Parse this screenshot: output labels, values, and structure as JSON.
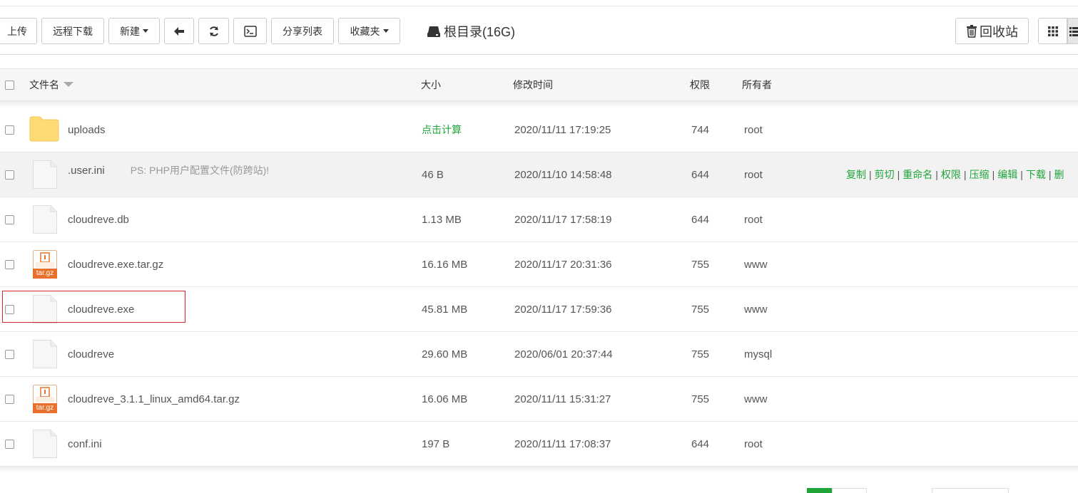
{
  "toolbar": {
    "upload": "上传",
    "remote_download": "远程下载",
    "new": "新建",
    "share_list": "分享列表",
    "favorites": "收藏夹",
    "current_dir": "根目录(16G)",
    "recycle_bin": "回收站"
  },
  "table": {
    "headers": {
      "filename": "文件名",
      "size": "大小",
      "modified": "修改时间",
      "permission": "权限",
      "owner": "所有者"
    },
    "rows": [
      {
        "name": "uploads",
        "type": "folder",
        "size": "点击计算",
        "modified": "2020/11/11 17:19:25",
        "perm": "744",
        "owner": "root"
      },
      {
        "name": ".user.ini",
        "type": "file",
        "note": "PS: PHP用户配置文件(防跨站)!",
        "size": "46 B",
        "modified": "2020/11/10 14:58:48",
        "perm": "644",
        "owner": "root",
        "actions": [
          "复制",
          "剪切",
          "重命名",
          "权限",
          "压缩",
          "编辑",
          "下载",
          "删"
        ]
      },
      {
        "name": "cloudreve.db",
        "type": "file",
        "size": "1.13 MB",
        "modified": "2020/11/17 17:58:19",
        "perm": "644",
        "owner": "root"
      },
      {
        "name": "cloudreve.exe.tar.gz",
        "type": "archive",
        "size": "16.16 MB",
        "modified": "2020/11/17 20:31:36",
        "perm": "755",
        "owner": "www"
      },
      {
        "name": "cloudreve.exe",
        "type": "file",
        "size": "45.81 MB",
        "modified": "2020/11/17 17:59:36",
        "perm": "755",
        "owner": "www"
      },
      {
        "name": "cloudreve",
        "type": "file",
        "size": "29.60 MB",
        "modified": "2020/06/01 20:37:44",
        "perm": "755",
        "owner": "mysql"
      },
      {
        "name": "cloudreve_3.1.1_linux_amd64.tar.gz",
        "type": "archive",
        "size": "16.06 MB",
        "modified": "2020/11/11 15:31:27",
        "perm": "755",
        "owner": "www"
      },
      {
        "name": "conf.ini",
        "type": "file",
        "size": "197 B",
        "modified": "2020/11/11 17:08:37",
        "perm": "644",
        "owner": "root"
      }
    ]
  },
  "archive_badge": "tar.gz",
  "colors": {
    "accent": "#20a53a",
    "highlight": "#d9262c",
    "archive": "#e8702a",
    "folder": "#fddc75"
  }
}
